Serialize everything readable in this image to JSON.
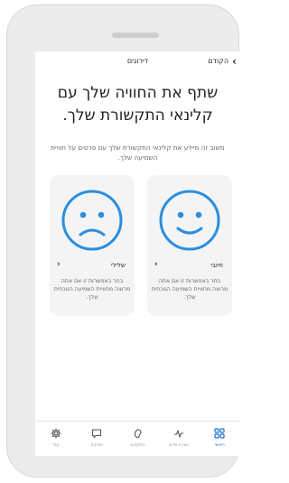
{
  "nav": {
    "back_label": "הקודם",
    "title": "דירוגים"
  },
  "headline": "שתף את החוויה שלך עם קלינאי התקשורת שלך.",
  "subtext": "משוב זה מיידע את קלינאי התקשורת שלך עם פרטים על חוויית השמיעה שלך.",
  "cards": {
    "positive": {
      "label": "חיובי",
      "description": "בחר באפשרות זו אם אתה מרוצה מחוויית השמיעה הנוכחית שלך."
    },
    "negative": {
      "label": "שלילי",
      "description": "בחר באפשרות זו אם אתה מרוצה מחוויית השמיעה הנוכחית שלך."
    }
  },
  "tabs": [
    {
      "label": "ראשי",
      "icon": "home-grid-icon",
      "active": true
    },
    {
      "label": "שורת מיים",
      "icon": "activity-icon",
      "active": false
    },
    {
      "label": "התקנים",
      "icon": "hearing-aid-icon",
      "active": false
    },
    {
      "label": "תמיכה",
      "icon": "chat-icon",
      "active": false
    },
    {
      "label": "עוד",
      "icon": "gear-icon",
      "active": false
    }
  ],
  "colors": {
    "accent": "#1a6fd0",
    "face": "#2a8fe0"
  }
}
